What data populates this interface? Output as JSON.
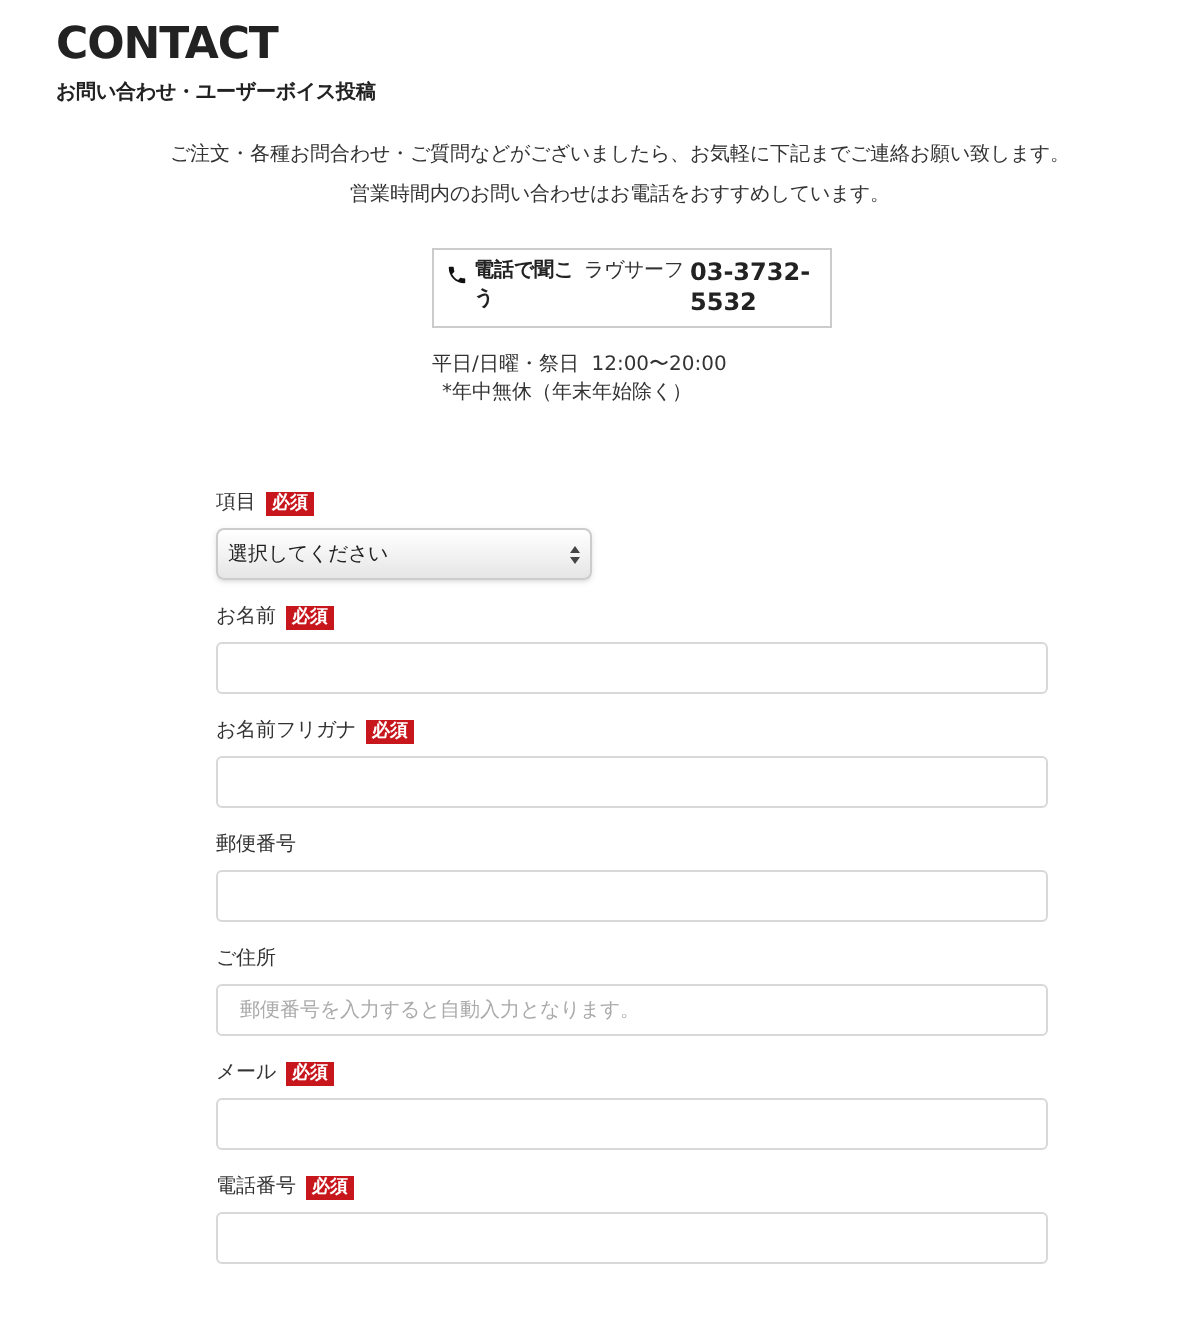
{
  "header": {
    "title": "CONTACT",
    "subtitle": "お問い合わせ・ユーザーボイス投稿"
  },
  "intro": [
    "ご注文・各種お問合わせ・ご質問などがございましたら、お気軽に下記までご連絡お願い致します。",
    "営業時間内のお問い合わせはお電話をおすすめしています。"
  ],
  "phone": {
    "label": "電話で聞こう",
    "company": "ラヴサーフ",
    "number": "03-3732-5532"
  },
  "hours": [
    "平日/日曜・祭日  12:00〜20:00",
    "*年中無休（年末年始除く）"
  ],
  "fields": [
    {
      "kind": "select",
      "label": "項目",
      "badge": "必須",
      "value": "選択してください"
    },
    {
      "kind": "text",
      "label": "お名前",
      "badge": "必須"
    },
    {
      "kind": "text",
      "label": "お名前フリガナ",
      "badge": "必須"
    },
    {
      "kind": "text",
      "label": "郵便番号"
    },
    {
      "kind": "text",
      "label": "ご住所",
      "placeholder": "郵便番号を入力すると自動入力となります。"
    },
    {
      "kind": "text",
      "label": "メール",
      "badge": "必須"
    },
    {
      "kind": "text",
      "label": "電話番号",
      "badge": "必須"
    }
  ]
}
